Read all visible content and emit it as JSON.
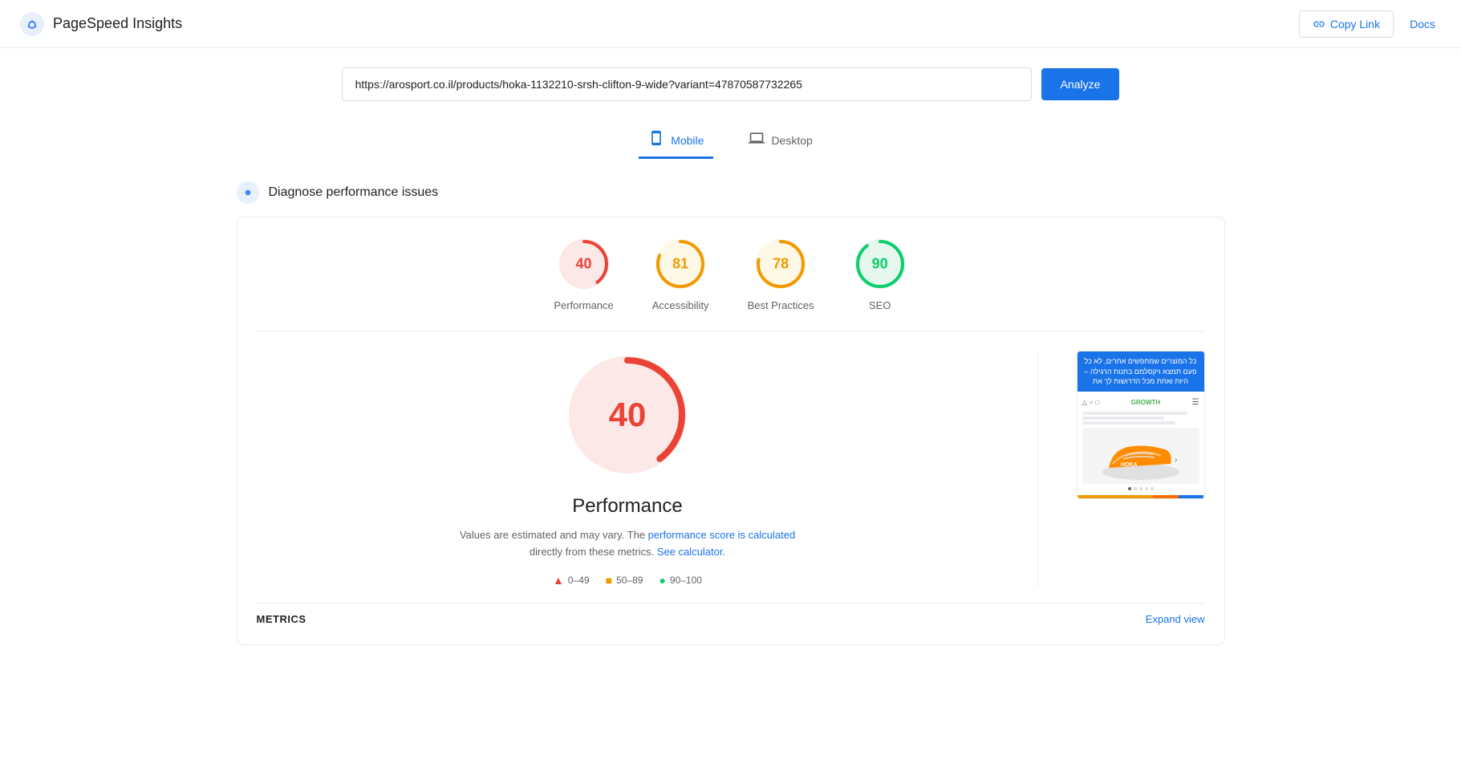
{
  "header": {
    "logo_text": "PageSpeed Insights",
    "copy_link_label": "Copy Link",
    "docs_label": "Docs"
  },
  "url_bar": {
    "url_value": "https://arosport.co.il/products/hoka-1132210-srsh-clifton-9-wide?variant=47870587732265",
    "analyze_label": "Analyze"
  },
  "tabs": [
    {
      "id": "mobile",
      "label": "Mobile",
      "active": true
    },
    {
      "id": "desktop",
      "label": "Desktop",
      "active": false
    }
  ],
  "section": {
    "title": "Diagnose performance issues"
  },
  "scores": [
    {
      "id": "performance",
      "value": 40,
      "label": "Performance",
      "color": "#ea4335",
      "bg": "#fce8e6",
      "track": "#fce8e6",
      "pct": 40
    },
    {
      "id": "accessibility",
      "value": 81,
      "label": "Accessibility",
      "color": "#f29900",
      "bg": "#fef9e7",
      "track": "#fef9e7",
      "pct": 81
    },
    {
      "id": "best-practices",
      "value": 78,
      "label": "Best Practices",
      "color": "#f29900",
      "bg": "#fef9e7",
      "track": "#fef9e7",
      "pct": 78
    },
    {
      "id": "seo",
      "value": 90,
      "label": "SEO",
      "color": "#0cce6b",
      "bg": "#e6f8ee",
      "track": "#e6f8ee",
      "pct": 90
    }
  ],
  "detail": {
    "score": 40,
    "title": "Performance",
    "desc_text": "Values are estimated and may vary. The ",
    "link1_text": "performance score is calculated",
    "desc_mid": "directly from these metrics.",
    "link2_text": "See calculator.",
    "link1_href": "#",
    "link2_href": "#"
  },
  "legend": [
    {
      "range": "0–49",
      "color": "red"
    },
    {
      "range": "50–89",
      "color": "orange"
    },
    {
      "range": "90–100",
      "color": "green"
    }
  ],
  "screenshot": {
    "banner_text": "כל המוצרים שמחפשים אחרים, לא כל פעם תמצא ויקסלמם בחנות הרגילה – היות ואחת מכל הדרושות לך את",
    "logo_text": "GROWTH",
    "nav_text": "☰",
    "line1_width": "90%",
    "line2_width": "70%",
    "line3_width": "80%",
    "dots": [
      true,
      false,
      false,
      false,
      false
    ]
  },
  "metrics": {
    "label": "METRICS",
    "expand_label": "Expand view"
  },
  "colors": {
    "brand_blue": "#1a73e8",
    "red": "#ea4335",
    "orange": "#f29900",
    "green": "#0cce6b",
    "track_gray": "#e8eaed"
  }
}
